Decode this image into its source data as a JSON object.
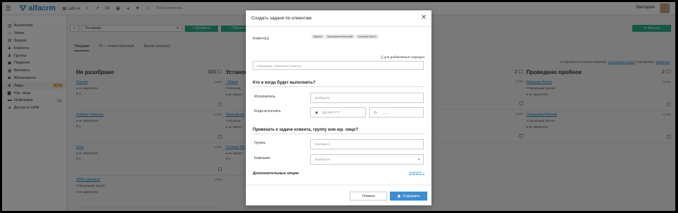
{
  "topbar": {
    "brand": "alfacrm",
    "branch": "Labs",
    "search_placeholder": "Поиск клиента",
    "user": "Виктория"
  },
  "sidebar": {
    "items": [
      {
        "label": "Аналитика",
        "icon": "chart-icon"
      },
      {
        "label": "Уроки",
        "icon": "calendar-icon"
      },
      {
        "label": "Задачи",
        "icon": "tasks-icon"
      },
      {
        "label": "Клиенты",
        "icon": "user-icon"
      },
      {
        "label": "Группы",
        "icon": "group-icon"
      },
      {
        "label": "Педагоги",
        "icon": "teacher-icon"
      },
      {
        "label": "Финансы",
        "icon": "finance-icon"
      },
      {
        "label": "Абонементы",
        "icon": "ticket-icon"
      },
      {
        "label": "Лиды",
        "icon": "leads-icon",
        "badge": "323"
      },
      {
        "label": "Юр. лица",
        "icon": "building-icon"
      },
      {
        "label": "Информер",
        "icon": "info-icon",
        "badge": "0"
      },
      {
        "label": "Доступ в CRM",
        "icon": "lock-icon"
      }
    ]
  },
  "toolbar": {
    "select_value": "Основная",
    "add_label": "+ Добавить",
    "assign_label": "✓ Принять",
    "filter_label": "▼ Фильтр"
  },
  "tabs": [
    "Текущие",
    "Я — ответственный",
    "Архив (отказы)"
  ],
  "sort_info": {
    "text": "Отображено 6 этапов воронки.",
    "configure": "Настройка полей",
    "sort_label": "Сортировка:",
    "sort_value": "Фамилия"
  },
  "columns": [
    {
      "title": "Не разобрано",
      "count": "323",
      "cards": [
        {
          "name": "Ксения",
          "time": "14:06",
          "line1": "♦ не закреплен",
          "line2": "₽ 0"
        },
        {
          "name": "Кобякин Николас",
          "time": "14:06",
          "line1": "♦ не закреплен",
          "line2": "₽ 1"
        },
        {
          "name": "Егор",
          "time": "14:06",
          "line1": "♦ не закреплен",
          "line2": "₽ 1"
        },
        {
          "name": "Айбук Данияль",
          "time": "14:06",
          "line1": "⟲ Входящий звонок",
          "line2": "♦ не закреплен"
        }
      ]
    },
    {
      "title": "Установ",
      "count": "",
      "cards": [
        {
          "name": "- Мария",
          "time": "",
          "line1": "⟲ Входящ",
          "line2": "♦ не закреп"
        },
        {
          "name": "Прокофьев",
          "time": "",
          "line1": "⟲ Входящ",
          "line2": "♦ не закреп"
        },
        {
          "name": "Соткова Ма",
          "time": "",
          "line1": "♦ не закреп",
          "line2": "₽ 0"
        }
      ]
    },
    {
      "title": "Проведено пробное",
      "count": "2",
      "cards": [
        {
          "name": "Мамаева Алиса",
          "time": "14:06",
          "line1": "⟲ Входящий звонок",
          "line2": "♦ не закреплен"
        },
        {
          "name": "Олышкаев Максим",
          "time": "14:06",
          "line1": "⟲ Входящий звонок",
          "line2": "♦ не закреплен"
        }
      ]
    }
  ],
  "mid_column": {
    "count": "2",
    "times": [
      "14:06",
      "14:06"
    ]
  },
  "modal": {
    "title": "Создать задачи по клиентам",
    "clients_label": "Клиент(ы)",
    "clients": [
      "Мария",
      "Прокофьев Николай",
      "Соткова Настя"
    ],
    "sub_checkbox": "[ ] для добавляемые подзадач",
    "textarea_placeholder": "Например, позвонить клиенту",
    "section_who": "Кто и когда будет выполнять?",
    "executor_label": "Исполнитель",
    "executor_placeholder": "Выберите",
    "when_label": "Когда исполнить",
    "date_placeholder": "ДД.ММ.ГГГГ",
    "time_placeholder": "__:__",
    "section_link": "Привязать к задаче клиента, группу или юр. лицо?",
    "group_label": "Группа",
    "group_placeholder": "Выберите",
    "company_label": "Компания",
    "company_placeholder": "Выберите",
    "extra_label": "Дополнительные опции",
    "show_link": "показать ↓",
    "cancel_label": "Отмена",
    "save_label": "Сохранить"
  }
}
